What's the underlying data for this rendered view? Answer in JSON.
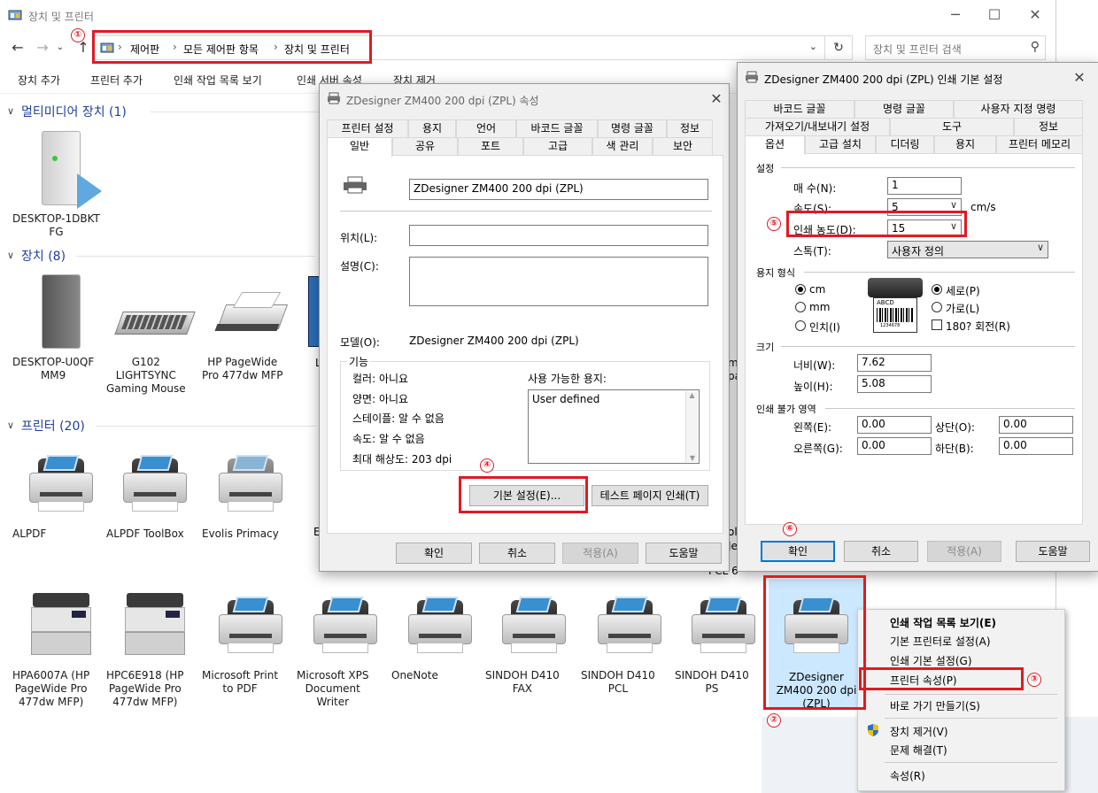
{
  "explorer": {
    "title": "장치 및 프린터",
    "breadcrumb": [
      "제어판",
      "모든 제어판 항목",
      "장치 및 프린터"
    ],
    "search_placeholder": "장치 및 프린터 검색",
    "commands": [
      "장치 추가",
      "프린터 추가",
      "인쇄 작업 목록 보기",
      "인쇄 서버 속성",
      "장치 제거"
    ],
    "groups": {
      "multimedia": "멀티미디어 장치 (1)",
      "devices": "장치 (8)",
      "printers": "프린터 (20)"
    },
    "multimedia_items": [
      {
        "label": "DESKTOP-1DBKT\nFG"
      }
    ],
    "device_items": [
      {
        "label": "DESKTOP-U0QF\nMM9"
      },
      {
        "label": "G102\nLIGHTSYNC\nGaming Mouse"
      },
      {
        "label": "HP PageWide\nPro 477dw MFP"
      }
    ],
    "printer_row1": [
      {
        "label": "ALPDF"
      },
      {
        "label": "ALPDF ToolBox"
      },
      {
        "label": "Evolis Primacy"
      }
    ],
    "printer_row2": [
      {
        "label": "HPA6007A (HP\nPageWide Pro\n477dw MFP)"
      },
      {
        "label": "HPC6E918 (HP\nPageWide Pro\n477dw MFP)"
      },
      {
        "label": "Microsoft Print\nto PDF"
      },
      {
        "label": "Microsoft XPS\nDocument\nWriter"
      },
      {
        "label": "OneNote"
      },
      {
        "label": "SINDOH D410\nFAX"
      },
      {
        "label": "SINDOH D410\nPCL"
      },
      {
        "label": "SINDOH D410\nPS"
      },
      {
        "label": "ZDesigner\nZM400 200 dpi\n(ZPL)"
      }
    ],
    "partial_labels": {
      "l1": "L",
      "e1": "E",
      "m1": "m",
      "pa": "pa",
      "ol": "ol",
      "je": "Je",
      "pcl6": "PCL 6"
    }
  },
  "props": {
    "title": "ZDesigner ZM400 200 dpi (ZPL) 속성",
    "tabs_row1": [
      "프린터 설정",
      "용지",
      "언어",
      "바코드 글꼴",
      "명령 글꼴",
      "정보"
    ],
    "tabs_row2": [
      "일반",
      "공유",
      "포트",
      "고급",
      "색 관리",
      "보안"
    ],
    "name_value": "ZDesigner ZM400 200 dpi (ZPL)",
    "location_label": "위치(L):",
    "comment_label": "설명(C):",
    "model_label": "모델(O):",
    "model_value": "ZDesigner ZM400 200 dpi (ZPL)",
    "features_label": "기능",
    "color": "컬러: 아니요",
    "duplex": "양면: 아니요",
    "staple": "스테이플: 알 수 없음",
    "speed": "속도: 알 수 없음",
    "maxres": "최대 해상도: 203 dpi",
    "paper_avail_label": "사용 가능한 용지:",
    "paper_avail_value": "User defined",
    "pref_button": "기본 설정(E)...",
    "test_button": "테스트 페이지 인쇄(T)",
    "ok": "확인",
    "cancel": "취소",
    "apply": "적용(A)",
    "help": "도움말"
  },
  "prefs": {
    "title": "ZDesigner ZM400 200 dpi (ZPL) 인쇄 기본 설정",
    "tabs_row1": [
      "바코드 글꼴",
      "명령 글꼴",
      "사용자 지정 명령"
    ],
    "tabs_row2": [
      "가져오기/내보내기 설정",
      "도구",
      "정보"
    ],
    "tabs_row3": [
      "옵션",
      "고급 설치",
      "디더링",
      "용지",
      "프린터 메모리"
    ],
    "settings_label": "설정",
    "copies_label": "매 수(N):",
    "copies_value": "1",
    "speed_label": "속도(S):",
    "speed_value": "5",
    "speed_unit": "cm/s",
    "darkness_label": "인쇄 농도(D):",
    "darkness_value": "15",
    "stock_label": "스톡(T):",
    "stock_value": "사용자 정의",
    "paper_format_label": "용지 형식",
    "unit_cm": "cm",
    "unit_mm": "mm",
    "unit_inch": "인치(I)",
    "orient_portrait": "세로(P)",
    "orient_landscape": "가로(L)",
    "rotate": "180? 회전(R)",
    "label_preview": "ABCD",
    "label_preview_sub": "1234678",
    "size_label": "크기",
    "width_label": "너비(W):",
    "width_value": "7.62",
    "height_label": "높이(H):",
    "height_value": "5.08",
    "unprintable_label": "인쇄 불가 영역",
    "left_label": "왼쪽(E):",
    "left_value": "0.00",
    "top_label": "상단(O):",
    "top_value": "0.00",
    "right_label": "오른쪽(G):",
    "right_value": "0.00",
    "bottom_label": "하단(B):",
    "bottom_value": "0.00",
    "ok": "확인",
    "cancel": "취소",
    "apply": "적용(A)",
    "help": "도움말"
  },
  "context_menu": {
    "items": [
      "인쇄 작업 목록 보기(E)",
      "기본 프린터로 설정(A)",
      "인쇄 기본 설정(G)",
      "프린터 속성(P)",
      "바로 가기 만들기(S)",
      "장치 제거(V)",
      "문제 해결(T)",
      "속성(R)"
    ]
  },
  "annotations": [
    "①",
    "②",
    "③",
    "④",
    "⑤",
    "⑥"
  ],
  "colors": {
    "annotation_red": "#e01a22",
    "accent_blue": "#0078d7",
    "group_header": "#1e3f9e"
  }
}
